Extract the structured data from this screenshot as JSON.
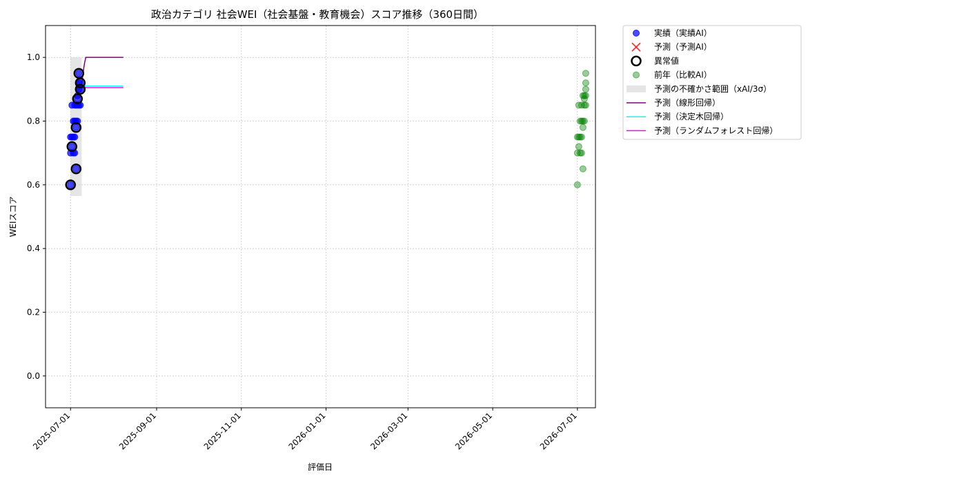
{
  "chart_data": {
    "type": "scatter",
    "title": "政治カテゴリ 社会WEI（社会基盤・教育機会）スコア推移（360日間）",
    "xlabel": "評価日",
    "ylabel": "WEIスコア",
    "xlim": [
      "2025-06-13",
      "2026-07-14"
    ],
    "ylim": [
      -0.1,
      1.1
    ],
    "grid": true,
    "legend_position": "outside-top-right",
    "x_ticks": [
      "2025-07-01",
      "2025-09-01",
      "2025-11-01",
      "2026-01-01",
      "2026-03-01",
      "2026-05-01",
      "2026-07-01"
    ],
    "y_ticks": [
      0.0,
      0.2,
      0.4,
      0.6,
      0.8,
      1.0
    ],
    "legend": [
      {
        "key": "actual",
        "label": "実績（実績AI）"
      },
      {
        "key": "predicted",
        "label": "予測（予測AI）"
      },
      {
        "key": "anomaly",
        "label": "異常値"
      },
      {
        "key": "prev_year",
        "label": "前年（比較AI）"
      },
      {
        "key": "band",
        "label": "予測の不確かさ範囲（xAI/3σ）"
      },
      {
        "key": "linear",
        "label": "予測（線形回帰）"
      },
      {
        "key": "tree",
        "label": "予測（決定木回帰）"
      },
      {
        "key": "forest",
        "label": "予測（ランダムフォレスト回帰）"
      }
    ],
    "colors": {
      "actual": "#0000ff",
      "predicted": "#ff0000",
      "anomaly": "#000000",
      "prev_year": "#008000",
      "band": "#d3d3d3",
      "linear": "#800080",
      "tree": "#00ffff",
      "forest": "#ff00ff"
    },
    "series": [
      {
        "key": "actual",
        "points": [
          [
            "2025-07-01",
            0.6
          ],
          [
            "2025-07-01",
            0.7
          ],
          [
            "2025-07-01",
            0.75
          ],
          [
            "2025-07-02",
            0.72
          ],
          [
            "2025-07-02",
            0.75
          ],
          [
            "2025-07-02",
            0.85
          ],
          [
            "2025-07-03",
            0.7
          ],
          [
            "2025-07-03",
            0.75
          ],
          [
            "2025-07-03",
            0.8
          ],
          [
            "2025-07-04",
            0.7
          ],
          [
            "2025-07-04",
            0.75
          ],
          [
            "2025-07-04",
            0.8
          ],
          [
            "2025-07-04",
            0.85
          ],
          [
            "2025-07-05",
            0.65
          ],
          [
            "2025-07-05",
            0.78
          ],
          [
            "2025-07-05",
            0.8
          ],
          [
            "2025-07-05",
            0.85
          ],
          [
            "2025-07-06",
            0.8
          ],
          [
            "2025-07-06",
            0.85
          ],
          [
            "2025-07-06",
            0.87
          ],
          [
            "2025-07-06",
            0.88
          ],
          [
            "2025-07-07",
            0.85
          ],
          [
            "2025-07-07",
            0.9
          ],
          [
            "2025-07-07",
            0.92
          ],
          [
            "2025-07-07",
            0.95
          ],
          [
            "2025-07-08",
            0.85
          ],
          [
            "2025-07-08",
            0.9
          ],
          [
            "2025-07-08",
            0.92
          ]
        ]
      },
      {
        "key": "anomaly",
        "points": [
          [
            "2025-07-01",
            0.6
          ],
          [
            "2025-07-02",
            0.72
          ],
          [
            "2025-07-05",
            0.65
          ],
          [
            "2025-07-05",
            0.78
          ],
          [
            "2025-07-06",
            0.87
          ],
          [
            "2025-07-07",
            0.95
          ],
          [
            "2025-07-08",
            0.92
          ],
          [
            "2025-07-08",
            0.9
          ]
        ]
      },
      {
        "key": "prev_year",
        "points": [
          [
            "2026-07-01",
            0.6
          ],
          [
            "2026-07-01",
            0.7
          ],
          [
            "2026-07-01",
            0.75
          ],
          [
            "2026-07-02",
            0.72
          ],
          [
            "2026-07-02",
            0.75
          ],
          [
            "2026-07-02",
            0.85
          ],
          [
            "2026-07-03",
            0.7
          ],
          [
            "2026-07-03",
            0.75
          ],
          [
            "2026-07-03",
            0.8
          ],
          [
            "2026-07-04",
            0.7
          ],
          [
            "2026-07-04",
            0.75
          ],
          [
            "2026-07-04",
            0.8
          ],
          [
            "2026-07-04",
            0.85
          ],
          [
            "2026-07-05",
            0.65
          ],
          [
            "2026-07-05",
            0.78
          ],
          [
            "2026-07-05",
            0.8
          ],
          [
            "2026-07-05",
            0.88
          ],
          [
            "2026-07-06",
            0.8
          ],
          [
            "2026-07-06",
            0.85
          ],
          [
            "2026-07-06",
            0.87
          ],
          [
            "2026-07-06",
            0.88
          ],
          [
            "2026-07-07",
            0.85
          ],
          [
            "2026-07-07",
            0.88
          ],
          [
            "2026-07-07",
            0.9
          ],
          [
            "2026-07-07",
            0.92
          ],
          [
            "2026-07-07",
            0.95
          ]
        ]
      },
      {
        "key": "band",
        "x_start": "2025-07-01",
        "x_end": "2025-07-09",
        "y_low": 0.565,
        "y_high": 1.0
      },
      {
        "key": "linear",
        "points": [
          [
            "2025-07-09",
            0.91
          ],
          [
            "2025-07-10",
            0.95
          ],
          [
            "2025-07-11",
            0.98
          ],
          [
            "2025-07-12",
            1.0
          ],
          [
            "2025-08-08",
            1.0
          ]
        ]
      },
      {
        "key": "tree",
        "points": [
          [
            "2025-07-09",
            0.91
          ],
          [
            "2025-08-08",
            0.91
          ]
        ]
      },
      {
        "key": "forest",
        "points": [
          [
            "2025-07-09",
            0.905
          ],
          [
            "2025-08-08",
            0.905
          ]
        ]
      }
    ]
  }
}
